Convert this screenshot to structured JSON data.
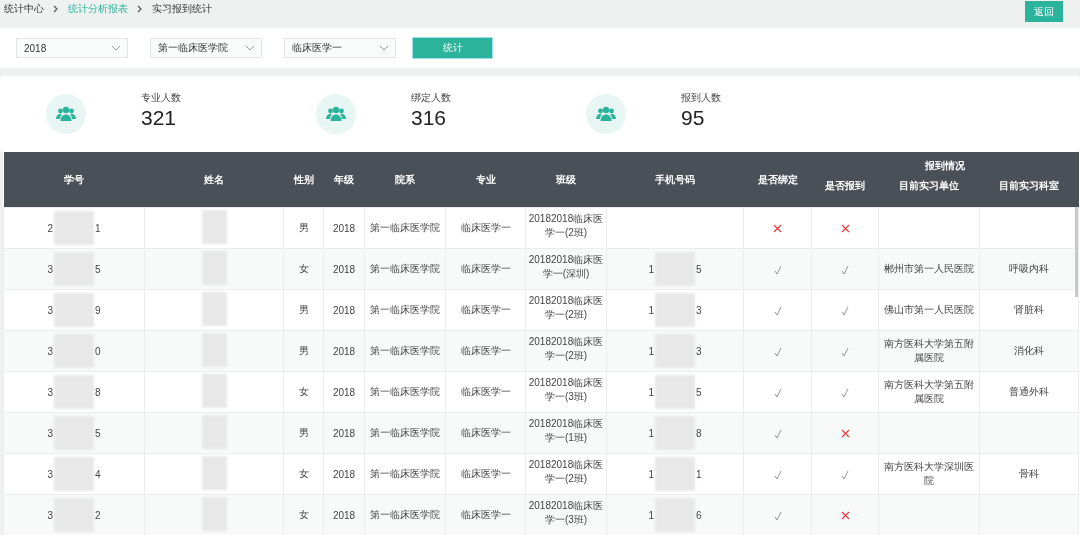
{
  "breadcrumb": [
    {
      "label": "统计中心",
      "kind": "plain"
    },
    {
      "label": "统计分析报表",
      "kind": "link"
    },
    {
      "label": "实习报到统计",
      "kind": "current"
    }
  ],
  "back_button": "返回",
  "filters": [
    {
      "value": "2018"
    },
    {
      "value": "第一临床医学院"
    },
    {
      "value": "临床医学一"
    }
  ],
  "stat_button": "统计",
  "stats": [
    {
      "label": "专业人数",
      "value": "321"
    },
    {
      "label": "绑定人数",
      "value": "316"
    },
    {
      "label": "报到人数",
      "value": "95"
    }
  ],
  "table": {
    "columns": [
      "学号",
      "姓名",
      "性别",
      "年级",
      "院系",
      "专业",
      "班级",
      "手机号码",
      "是否绑定"
    ],
    "group": "报到情况",
    "group_columns": [
      "是否报到",
      "目前实习单位",
      "目前实习科室"
    ],
    "rows": [
      {
        "id_first": "2",
        "id_last": "1",
        "gender": "男",
        "grade": "2018",
        "school": "第一临床医学院",
        "major": "临床医学一",
        "class": "20182018临床医学一(2班)",
        "bound": false,
        "reported": false
      },
      {
        "id_first": "3",
        "id_last": "5",
        "gender": "女",
        "grade": "2018",
        "school": "第一临床医学院",
        "major": "临床医学一",
        "class": "20182018临床医学一(深圳)",
        "phone_first": "1",
        "phone_last": "5",
        "bound": true,
        "reported": true,
        "unit": "郴州市第一人民医院",
        "dept": "呼吸内科"
      },
      {
        "id_first": "3",
        "id_last": "9",
        "gender": "男",
        "grade": "2018",
        "school": "第一临床医学院",
        "major": "临床医学一",
        "class": "20182018临床医学一(2班)",
        "phone_first": "1",
        "phone_last": "3",
        "bound": true,
        "reported": true,
        "unit": "佛山市第一人民医院",
        "dept": "肾脏科"
      },
      {
        "id_first": "3",
        "id_last": "0",
        "gender": "男",
        "grade": "2018",
        "school": "第一临床医学院",
        "major": "临床医学一",
        "class": "20182018临床医学一(2班)",
        "phone_first": "1",
        "phone_last": "3",
        "bound": true,
        "reported": true,
        "unit": "南方医科大学第五附属医院",
        "dept": "消化科"
      },
      {
        "id_first": "3",
        "id_last": "8",
        "gender": "女",
        "grade": "2018",
        "school": "第一临床医学院",
        "major": "临床医学一",
        "class": "20182018临床医学一(3班)",
        "phone_first": "1",
        "phone_last": "5",
        "bound": true,
        "reported": true,
        "unit": "南方医科大学第五附属医院",
        "dept": "普通外科"
      },
      {
        "id_first": "3",
        "id_last": "5",
        "gender": "男",
        "grade": "2018",
        "school": "第一临床医学院",
        "major": "临床医学一",
        "class": "20182018临床医学一(1班)",
        "phone_first": "1",
        "phone_last": "8",
        "bound": true,
        "reported": false
      },
      {
        "id_first": "3",
        "id_last": "4",
        "gender": "女",
        "grade": "2018",
        "school": "第一临床医学院",
        "major": "临床医学一",
        "class": "20182018临床医学一(2班)",
        "phone_first": "1",
        "phone_last": "1",
        "bound": true,
        "reported": true,
        "unit": "南方医科大学深圳医院",
        "dept": "骨科"
      },
      {
        "id_first": "3",
        "id_last": "2",
        "gender": "女",
        "grade": "2018",
        "school": "第一临床医学院",
        "major": "临床医学一",
        "class": "20182018临床医学一(3班)",
        "phone_first": "1",
        "phone_last": "6",
        "bound": true,
        "reported": false
      }
    ]
  }
}
